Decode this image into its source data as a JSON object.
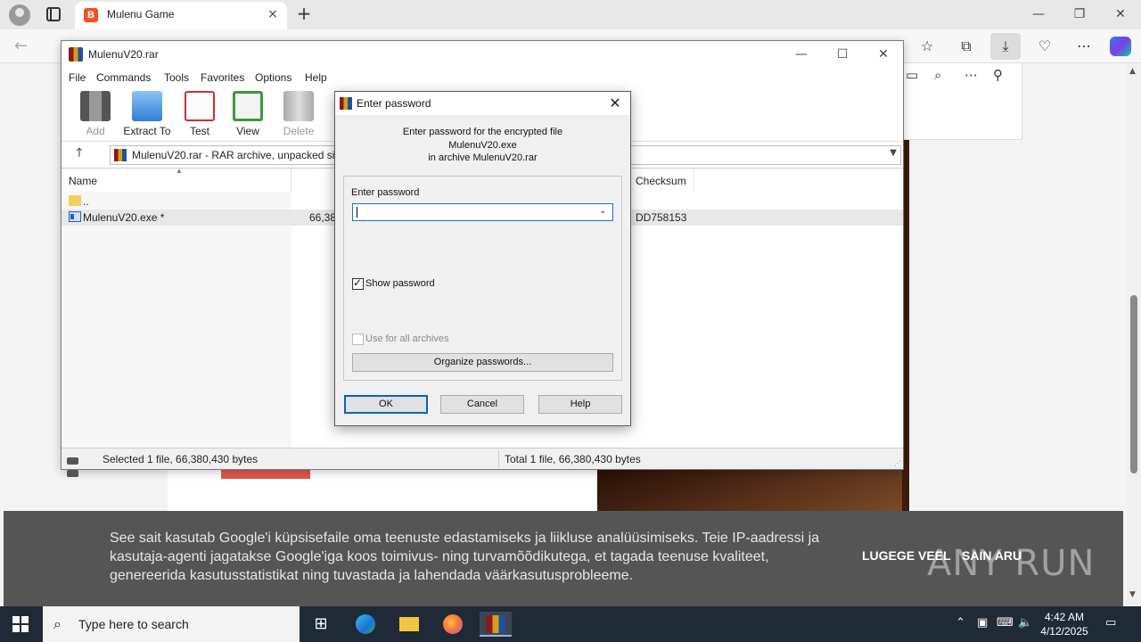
{
  "browser": {
    "tab_title": "Mulenu Game",
    "tab_favicon_letter": "B",
    "new_tab_symbol": "+",
    "close_symbol": "×",
    "win_min": "—",
    "win_max": "❐",
    "win_close": "✕"
  },
  "cookie": {
    "text": "See sait kasutab Google'i küpsisefaile oma teenuste edastamiseks ja liikluse analüüsimiseks. Teie IP-aadressi ja kasutaja-agenti jagatakse Google'iga koos toimivus- ning turvamõõdikutega, et tagada teenuse kvaliteet, genereerida kasutusstatistikat ning tuvastada ja lahendada väärkasutusprobleeme.",
    "learn_more": "LUGEGE VEEL",
    "accept": "SAIN ARU",
    "watermark": "ANY RUN"
  },
  "winrar": {
    "title": "MulenuV20.rar",
    "menu": [
      "File",
      "Commands",
      "Tools",
      "Favorites",
      "Options",
      "Help"
    ],
    "toolbar": [
      {
        "label": "Add",
        "icon": "add-icon",
        "enabled": false
      },
      {
        "label": "Extract To",
        "icon": "extract-icon",
        "enabled": true
      },
      {
        "label": "Test",
        "icon": "test-icon",
        "enabled": true
      },
      {
        "label": "View",
        "icon": "view-icon",
        "enabled": true
      },
      {
        "label": "Delete",
        "icon": "delete-icon",
        "enabled": false
      }
    ],
    "path": "MulenuV20.rar - RAR archive, unpacked size",
    "columns": {
      "name": "Name",
      "checksum": "Checksum"
    },
    "rows": [
      {
        "name": "..",
        "size": "",
        "checksum": "",
        "type": "folder"
      },
      {
        "name": "MulenuV20.exe *",
        "size": "66,38",
        "checksum": "DD758153",
        "type": "exe"
      }
    ],
    "status_left": "Selected 1 file, 66,380,430 bytes",
    "status_right": "Total 1 file, 66,380,430 bytes"
  },
  "dialog": {
    "title": "Enter password",
    "line1": "Enter password for the encrypted file",
    "line2": "MulenuV20.exe",
    "line3": "in archive MulenuV20.rar",
    "password_label": "Enter password",
    "password_value": "",
    "show_password_label": "Show password",
    "show_password_checked": true,
    "use_all_label": "Use for all archives",
    "use_all_checked": false,
    "organize_label": "Organize passwords...",
    "ok": "OK",
    "cancel": "Cancel",
    "help": "Help"
  },
  "taskbar": {
    "search_placeholder": "Type here to search",
    "time": "4:42 AM",
    "date": "4/12/2025"
  }
}
